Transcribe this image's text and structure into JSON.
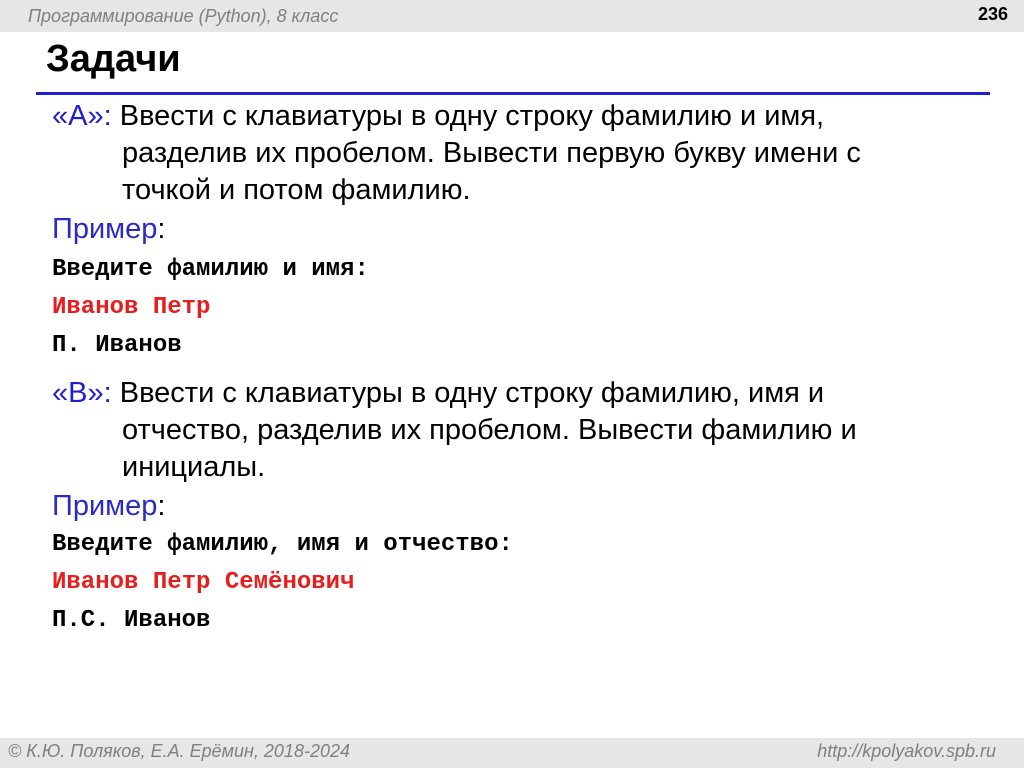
{
  "header": {
    "course": "Программирование (Python), 8 класс",
    "page_number": "236"
  },
  "title": "Задачи",
  "task_a": {
    "label": "«A»:",
    "line1": " Ввести с клавиатуры в одну строку фамилию и имя,",
    "line2": "разделив их пробелом. Вывести первую букву имени с",
    "line3": "точкой и потом фамилию.",
    "example_label": "Пример",
    "example_colon": ":",
    "prompt": "Введите фамилию и имя:",
    "input": "Иванов Петр",
    "output": "П. Иванов"
  },
  "task_b": {
    "label": "«B»:",
    "line1": " Ввести с клавиатуры в одну строку фамилию, имя и",
    "line2": "отчество, разделив их пробелом. Вывести фамилию и",
    "line3": "инициалы.",
    "example_label": "Пример",
    "example_colon": ":",
    "prompt": "Введите фамилию, имя и отчество:",
    "input": "Иванов Петр Семёнович",
    "output": "П.С. Иванов"
  },
  "footer": {
    "authors": "© К.Ю. Поляков, Е.А. Ерёмин, 2018-2024",
    "url": "http://kpolyakov.spb.ru"
  },
  "colors": {
    "accent": "#1f1fd1",
    "input_text": "#e61e1e",
    "bar": "#e6e6e6",
    "muted": "#808080"
  }
}
